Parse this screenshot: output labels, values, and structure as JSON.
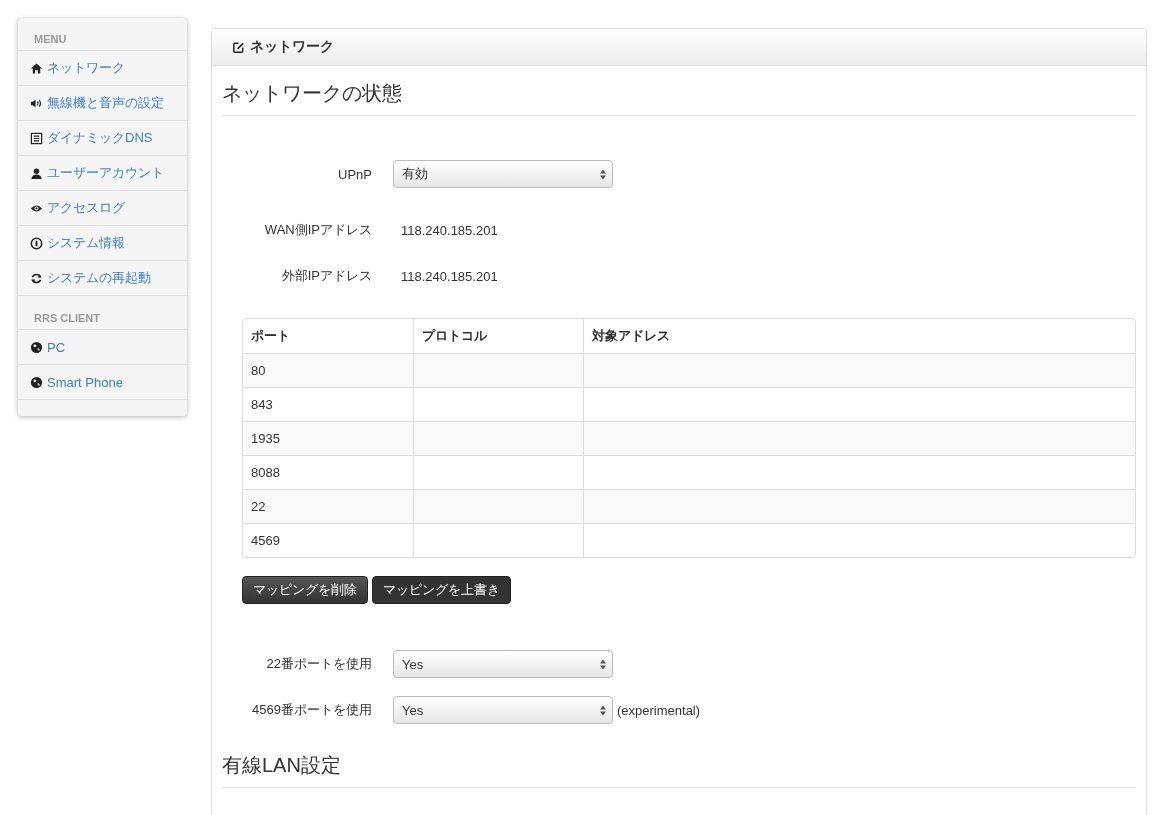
{
  "sidebar": {
    "sections": [
      {
        "heading": "MENU",
        "items": [
          {
            "label": "ネットワーク"
          },
          {
            "label": "無線機と音声の設定"
          },
          {
            "label": "ダイナミックDNS"
          },
          {
            "label": "ユーザーアカウント"
          },
          {
            "label": "アクセスログ"
          },
          {
            "label": "システム情報"
          },
          {
            "label": "システムの再起動"
          }
        ]
      },
      {
        "heading": "RRS CLIENT",
        "items": [
          {
            "label": "PC"
          },
          {
            "label": "Smart Phone"
          }
        ]
      }
    ]
  },
  "panel": {
    "title": "ネットワーク",
    "section_title": "ネットワークの状態",
    "upnp": {
      "label": "UPnP",
      "value": "有効"
    },
    "info": [
      {
        "label": "WAN側IPアドレス",
        "value": "118.240.185.201"
      },
      {
        "label": "外部IPアドレス",
        "value": "118.240.185.201"
      }
    ],
    "table": {
      "columns": [
        "ポート",
        "プロトコル",
        "対象アドレス"
      ],
      "rows": [
        [
          "80",
          "",
          ""
        ],
        [
          "843",
          "",
          ""
        ],
        [
          "1935",
          "",
          ""
        ],
        [
          "8088",
          "",
          ""
        ],
        [
          "22",
          "",
          ""
        ],
        [
          "4569",
          "",
          ""
        ]
      ]
    },
    "buttons": [
      "マッピングを削除",
      "マッピングを上書き"
    ],
    "port_settings": [
      {
        "label": "22番ポートを使用",
        "value": "Yes"
      },
      {
        "label": "4569番ポートを使用",
        "value": "Yes",
        "note": "(experimental)"
      }
    ],
    "next_section_title": "有線LAN設定"
  }
}
